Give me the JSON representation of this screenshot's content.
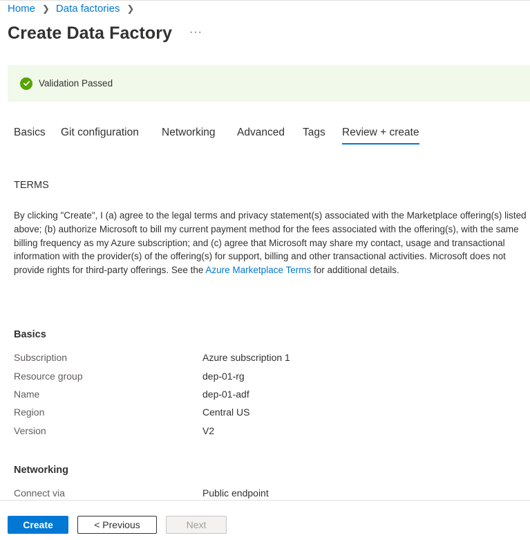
{
  "breadcrumb": {
    "items": [
      "Home",
      "Data factories"
    ],
    "separator": ">"
  },
  "page": {
    "title": "Create Data Factory",
    "more_label": "···"
  },
  "validation": {
    "text": "Validation Passed",
    "status": "passed",
    "icon": "checkmark-circle-icon",
    "color": "#57a300"
  },
  "tabs": [
    {
      "label": "Basics",
      "active": false
    },
    {
      "label": "Git configuration",
      "active": false
    },
    {
      "label": "Networking",
      "active": false
    },
    {
      "label": "Advanced",
      "active": false
    },
    {
      "label": "Tags",
      "active": false
    },
    {
      "label": "Review + create",
      "active": true
    }
  ],
  "terms": {
    "heading": "TERMS",
    "body_before_link": "By clicking \"Create\", I (a) agree to the legal terms and privacy statement(s) associated with the Marketplace offering(s) listed above; (b) authorize Microsoft to bill my current payment method for the fees associated with the offering(s), with the same billing frequency as my Azure subscription; and (c) agree that Microsoft may share my contact, usage and transactional information with the provider(s) of the offering(s) for support, billing and other transactional activities. Microsoft does not provide rights for third-party offerings. See the ",
    "link_text": "Azure Marketplace Terms",
    "body_after_link": " for additional details."
  },
  "basics": {
    "heading": "Basics",
    "rows": [
      {
        "label": "Subscription",
        "value": "Azure subscription 1"
      },
      {
        "label": "Resource group",
        "value": "dep-01-rg"
      },
      {
        "label": "Name",
        "value": "dep-01-adf"
      },
      {
        "label": "Region",
        "value": "Central US"
      },
      {
        "label": "Version",
        "value": "V2"
      }
    ]
  },
  "networking": {
    "heading": "Networking",
    "rows": [
      {
        "label": "Connect via",
        "value": "Public endpoint"
      }
    ]
  },
  "footer": {
    "create_label": "Create",
    "previous_label": "< Previous",
    "next_label": "Next",
    "accent_color": "#0078d4"
  }
}
